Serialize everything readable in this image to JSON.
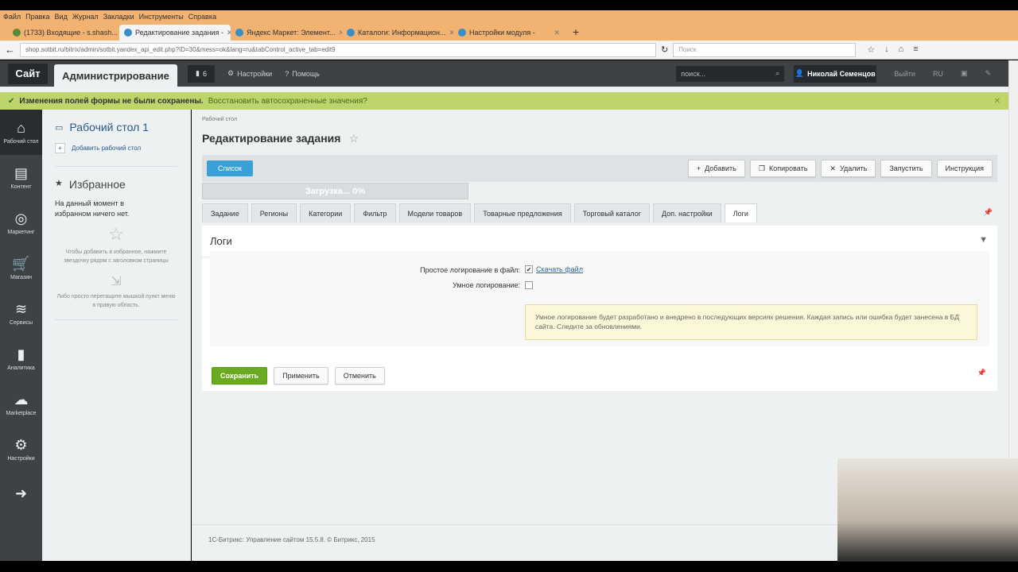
{
  "browser": {
    "menu": [
      "Файл",
      "Правка",
      "Вид",
      "Журнал",
      "Закладки",
      "Инструменты",
      "Справка"
    ],
    "tabs": [
      "(1733) Входящие - s.shash...",
      "Редактирование задания -",
      "Яндекс Маркет: Элемент...",
      "Каталоги: Информацион...",
      "Настройки модуля -"
    ],
    "url": "shop.sotbit.ru/bitrix/admin/sotbit.yandex_api_edit.php?ID=30&mess=ok&lang=ru&tabControl_active_tab=edit9",
    "search_placeholder": "Поиск"
  },
  "topnav": {
    "site": "Сайт",
    "admin": "Администрирование",
    "notifications": "6",
    "settings": "Настройки",
    "help": "Помощь",
    "search_placeholder": "поиск...",
    "user": "Николай Семенцов",
    "logout": "Выйти",
    "lang": "RU"
  },
  "alert": {
    "message": "Изменения полей формы не были сохранены.",
    "link": "Восстановить автосохраненные значения?"
  },
  "leftbar": [
    {
      "icon": "home-icon",
      "glyph": "⌂",
      "label": "Рабочий стол"
    },
    {
      "icon": "content-icon",
      "glyph": "▤",
      "label": "Контент"
    },
    {
      "icon": "marketing-icon",
      "glyph": "◎",
      "label": "Маркетинг"
    },
    {
      "icon": "cart-icon",
      "glyph": "🛒",
      "label": "Магазин"
    },
    {
      "icon": "layers-icon",
      "glyph": "≋",
      "label": "Сервисы"
    },
    {
      "icon": "chart-icon",
      "glyph": "▮",
      "label": "Аналитика"
    },
    {
      "icon": "cloud-icon",
      "glyph": "☁",
      "label": "Marketplace"
    },
    {
      "icon": "gear-icon",
      "glyph": "⚙",
      "label": "Настройки"
    },
    {
      "icon": "arrow-right-icon",
      "glyph": "➜",
      "label": ""
    }
  ],
  "panel": {
    "desktop": "Рабочий стол 1",
    "add_desktop": "Добавить рабочий стол",
    "favorites": "Избранное",
    "empty": "На данный момент в избранном ничего нет.",
    "hint1": "Чтобы добавить в избранное, нажмите звездочку рядом с заголовком страницы",
    "hint2": "Либо просто перетащите мышкой пункт меню в правую область."
  },
  "main": {
    "breadcrumb": "Рабочий стол",
    "title": "Редактирование задания",
    "list_button": "Список",
    "actions": [
      "Добавить",
      "Копировать",
      "Удалить",
      "Запустить",
      "Инструкция"
    ],
    "progress_text": "Загрузка... 0%",
    "progress": 0,
    "tabs": [
      "Задание",
      "Регионы",
      "Категории",
      "Фильтр",
      "Модели товаров",
      "Товарные предложения",
      "Торговый каталог",
      "Доп. настройки",
      "Логи"
    ],
    "section_title": "Логи",
    "field1_label": "Простое логирование в файл:",
    "field1_link": "Скачать файл",
    "field2_label": "Умное логирование:",
    "notice": "Умное логирование будет разработано и внедрено в последующих версиях решения. Каждая запись или ошибка будет занесена в БД сайта. Следите за обновлениями.",
    "save": "Сохранить",
    "apply": "Применить",
    "cancel": "Отменить",
    "footer": "1С-Битрикс: Управление сайтом 15.5.8. © Битрикс, 2015"
  }
}
